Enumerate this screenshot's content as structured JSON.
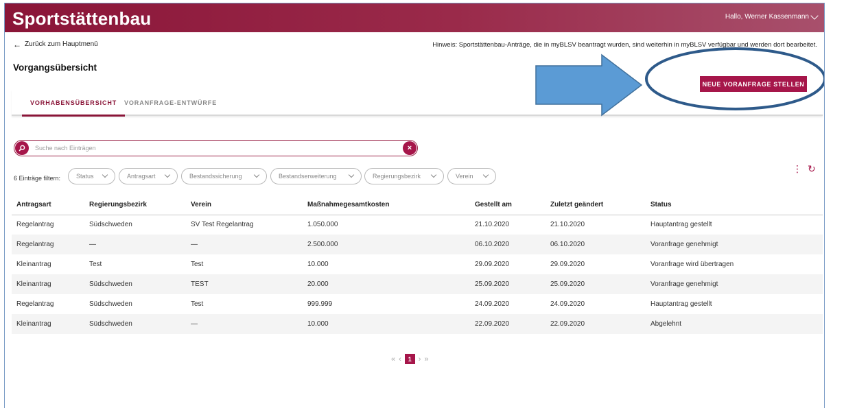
{
  "header": {
    "brand": "Sportstättenbau",
    "user_greeting": "Hallo, Werner Kassenmann"
  },
  "nav": {
    "back_label": "Zurück zum Hauptmenü",
    "hint": "Hinweis: Sportstättenbau-Anträge, die in myBLSV beantragt wurden, sind weiterhin in myBLSV verfügbar und werden dort bearbeitet."
  },
  "page": {
    "title": "Vorgangsübersicht",
    "primary_button": "NEUE VORANFRAGE STELLEN"
  },
  "tabs": [
    {
      "label": "VORHABENSÜBERSICHT",
      "active": true
    },
    {
      "label": "VORANFRAGE-ENTWÜRFE",
      "active": false
    }
  ],
  "search": {
    "placeholder": "Suche nach Einträgen",
    "clear_symbol": "×"
  },
  "filters": {
    "label": "6 Einträge filtern:",
    "chips": [
      "Status",
      "Antragsart",
      "Bestandssicherung",
      "Bestandserweiterung",
      "Regierungsbezirk",
      "Verein"
    ]
  },
  "table": {
    "columns": [
      "Antragsart",
      "Regierungsbezirk",
      "Verein",
      "Maßnahmegesamtkosten",
      "Gestellt am",
      "Zuletzt geändert",
      "Status"
    ],
    "rows": [
      [
        "Regelantrag",
        "Südschweden",
        "SV Test Regelantrag",
        "1.050.000",
        "21.10.2020",
        "21.10.2020",
        "Hauptantrag gestellt"
      ],
      [
        "Regelantrag",
        "—",
        "—",
        "2.500.000",
        "06.10.2020",
        "06.10.2020",
        "Voranfrage genehmigt"
      ],
      [
        "Kleinantrag",
        "Test",
        "Test",
        "10.000",
        "29.09.2020",
        "29.09.2020",
        "Voranfrage wird übertragen"
      ],
      [
        "Kleinantrag",
        "Südschweden",
        "TEST",
        "20.000",
        "25.09.2020",
        "25.09.2020",
        "Voranfrage genehmigt"
      ],
      [
        "Regelantrag",
        "Südschweden",
        "Test",
        "999.999",
        "24.09.2020",
        "24.09.2020",
        "Hauptantrag gestellt"
      ],
      [
        "Kleinantrag",
        "Südschweden",
        "—",
        "10.000",
        "22.09.2020",
        "22.09.2020",
        "Abgelehnt"
      ]
    ]
  },
  "pagination": {
    "first": "«",
    "prev": "‹",
    "current": "1",
    "next": "›",
    "last": "»"
  },
  "toolbar": {
    "more_symbol": "⋮",
    "refresh_symbol": "↻"
  },
  "colors": {
    "brand": "#8a1538",
    "accent": "#a6164a",
    "annotation_arrow": "#5b9bd5",
    "annotation_ellipse": "#2e5a8a"
  }
}
